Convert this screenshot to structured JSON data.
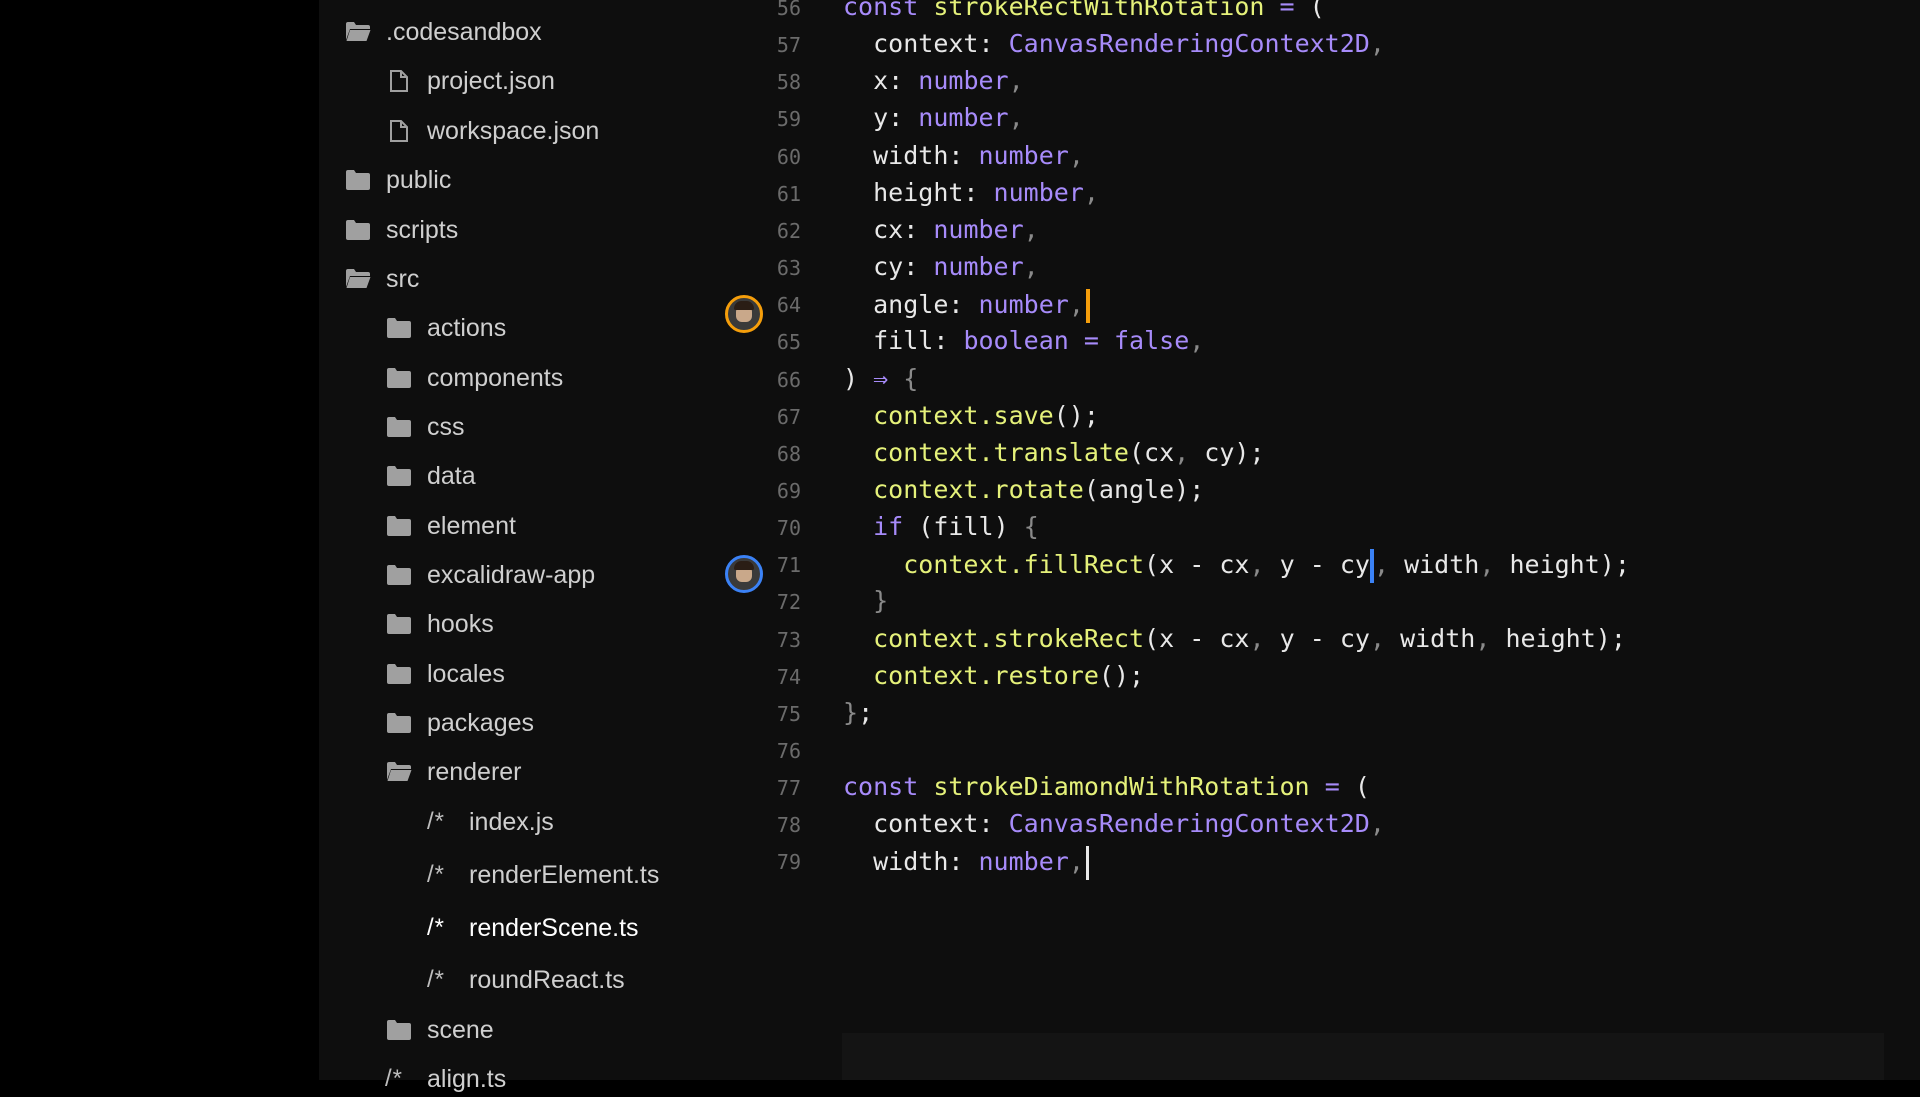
{
  "sidebar": {
    "items": [
      {
        "label": ".codesandbox",
        "icon": "folder-open-icon",
        "depth": 0
      },
      {
        "label": "project.json",
        "icon": "file-icon",
        "depth": 1
      },
      {
        "label": "workspace.json",
        "icon": "file-icon",
        "depth": 1
      },
      {
        "label": "public",
        "icon": "folder-icon",
        "depth": 0
      },
      {
        "label": "scripts",
        "icon": "folder-icon",
        "depth": 0
      },
      {
        "label": "src",
        "icon": "folder-open-icon",
        "depth": 0
      },
      {
        "label": "actions",
        "icon": "folder-icon",
        "depth": 1
      },
      {
        "label": "components",
        "icon": "folder-icon",
        "depth": 1
      },
      {
        "label": "css",
        "icon": "folder-icon",
        "depth": 1
      },
      {
        "label": "data",
        "icon": "folder-icon",
        "depth": 1
      },
      {
        "label": "element",
        "icon": "folder-icon",
        "depth": 1
      },
      {
        "label": "excalidraw-app",
        "icon": "folder-icon",
        "depth": 1
      },
      {
        "label": "hooks",
        "icon": "folder-icon",
        "depth": 1
      },
      {
        "label": "locales",
        "icon": "folder-icon",
        "depth": 1
      },
      {
        "label": "packages",
        "icon": "folder-icon",
        "depth": 1
      },
      {
        "label": "renderer",
        "icon": "folder-open-icon",
        "depth": 1
      },
      {
        "label": "index.js",
        "icon": "js-icon",
        "icon_glyph": "/*",
        "depth": 2
      },
      {
        "label": "renderElement.ts",
        "icon": "ts-icon",
        "icon_glyph": "/*",
        "depth": 2
      },
      {
        "label": "renderScene.ts",
        "icon": "ts-icon",
        "icon_glyph": "/*",
        "depth": 2,
        "active": true
      },
      {
        "label": "roundReact.ts",
        "icon": "ts-icon",
        "icon_glyph": "/*",
        "depth": 2
      },
      {
        "label": "scene",
        "icon": "folder-icon",
        "depth": 1
      },
      {
        "label": "align.ts",
        "icon": "ts-icon",
        "icon_glyph": "/*",
        "depth": 1
      }
    ]
  },
  "editor": {
    "lines": [
      {
        "num": "56",
        "text": "const strokeRectWithRotation = ("
      },
      {
        "num": "57",
        "text": "  context: CanvasRenderingContext2D,"
      },
      {
        "num": "58",
        "text": "  x: number,"
      },
      {
        "num": "59",
        "text": "  y: number,"
      },
      {
        "num": "60",
        "text": "  width: number,"
      },
      {
        "num": "61",
        "text": "  height: number,"
      },
      {
        "num": "62",
        "text": "  cx: number,"
      },
      {
        "num": "63",
        "text": "  cy: number,"
      },
      {
        "num": "64",
        "text": "  angle: number,",
        "cursor": "orange",
        "avatar": "orange"
      },
      {
        "num": "65",
        "text": "  fill: boolean = false,"
      },
      {
        "num": "66",
        "text": ") ⇒ {"
      },
      {
        "num": "67",
        "text": "  context.save();"
      },
      {
        "num": "68",
        "text": "  context.translate(cx, cy);"
      },
      {
        "num": "69",
        "text": "  context.rotate(angle);"
      },
      {
        "num": "70",
        "text": "  if (fill) {"
      },
      {
        "num": "71",
        "text": "    context.fillRect(x - cx, y - cy, width, height);",
        "cursor": "blue",
        "avatar": "blue"
      },
      {
        "num": "72",
        "text": "  }"
      },
      {
        "num": "73",
        "text": "  context.strokeRect(x - cx, y - cy, width, height);"
      },
      {
        "num": "74",
        "text": "  context.restore();"
      },
      {
        "num": "75",
        "text": "};"
      },
      {
        "num": "76",
        "text": ""
      },
      {
        "num": "77",
        "text": "const strokeDiamondWithRotation = ("
      },
      {
        "num": "78",
        "text": "  context: CanvasRenderingContext2D,"
      },
      {
        "num": "79",
        "text": "  width: number,",
        "cursor": "white"
      }
    ]
  },
  "colors": {
    "background": "#000000",
    "panel": "#0e0e0e",
    "keyword": "#a78bfa",
    "function": "#e5f17a",
    "cursor_orange": "#f59e0b",
    "cursor_blue": "#3b82f6"
  }
}
